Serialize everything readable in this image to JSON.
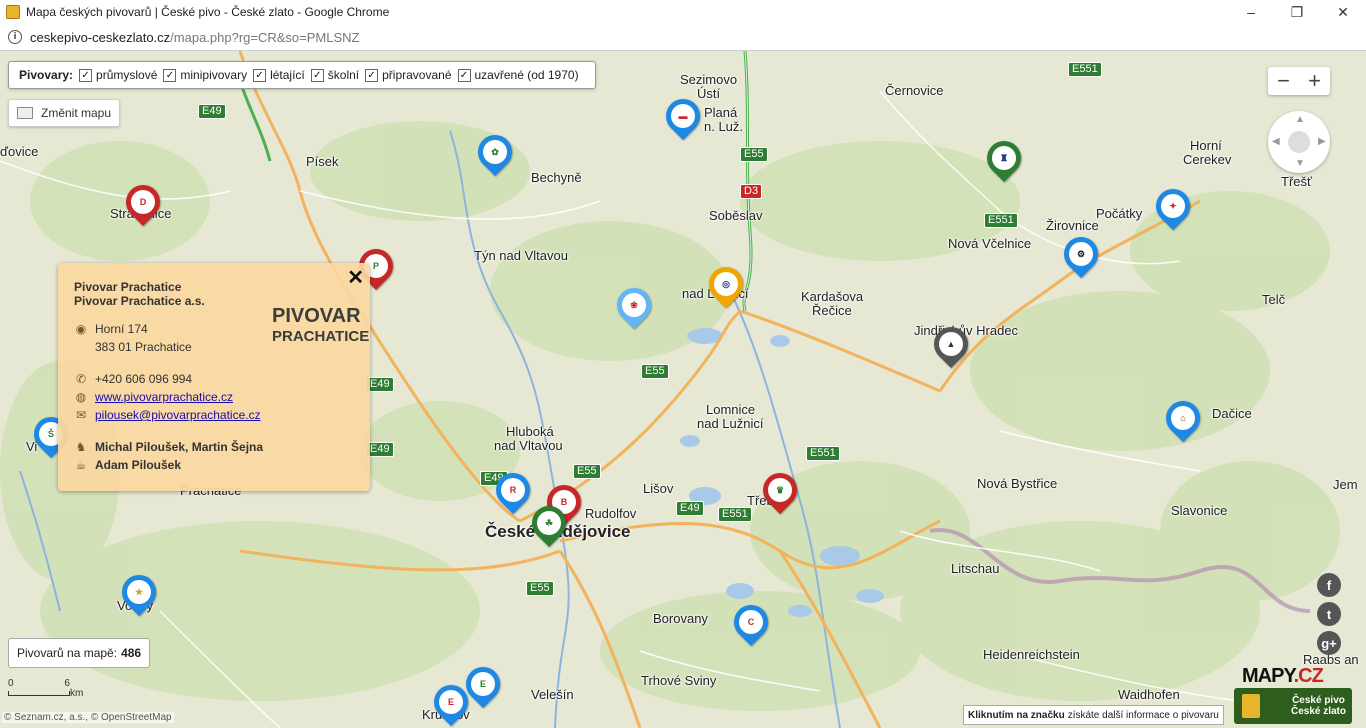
{
  "window": {
    "title": "Mapa českých pivovarů | České pivo - České zlato - Google Chrome",
    "minimize": "–",
    "restore": "❐",
    "close": "✕"
  },
  "address": {
    "host": "ceskepivo-ceskezlato.cz",
    "path": "/mapa.php?rg=CR&so=PMLSNZ"
  },
  "filter": {
    "label": "Pivovary:",
    "options": [
      {
        "label": "průmyslové",
        "checked": true
      },
      {
        "label": "minipivovary",
        "checked": true
      },
      {
        "label": "létající",
        "checked": true
      },
      {
        "label": "školní",
        "checked": true
      },
      {
        "label": "připravované",
        "checked": true
      },
      {
        "label": "uzavřené (od 1970)",
        "checked": true
      }
    ]
  },
  "change_map": "Změnit mapu",
  "zoom": {
    "minus": "−",
    "plus": "+"
  },
  "places": {
    "sezimovo1": "Sezimovo",
    "sezimovo2": "Ústí",
    "plana1": "Planá",
    "plana2": "n. Luž.",
    "cernovice": "Černovice",
    "pisek": "Písek",
    "bechyne": "Bechyně",
    "sobeslav": "Soběslav",
    "kardasova1": "Kardašova",
    "kardasova2": "Řečice",
    "horni1": "Horní",
    "horni2": "Cerekev",
    "trest": "Třešť",
    "pocatky": "Počátky",
    "zirovnice": "Žirovnice",
    "novavcelnice": "Nová Včelnice",
    "stradonice": "Strakonice",
    "dovice": "ďovice",
    "tyn": "Týn nad Vltavou",
    "veseli2": "nad Lužnicí",
    "telc": "Telč",
    "jindrichuv": "Jindřichův Hradec",
    "dacice": "Dačice",
    "lomnice1": "Lomnice",
    "lomnice2": "nad Lužnicí",
    "hluboka1": "Hluboká",
    "hluboka2": "nad Vltavou",
    "lisov": "Lišov",
    "rudolfov": "Rudolfov",
    "budejovice": "České Budějovice",
    "trebon": "Třeboň",
    "novabystrice": "Nová Bystřice",
    "slavonice": "Slavonice",
    "litschau": "Litschau",
    "borovany": "Borovany",
    "heidenreichstein": "Heidenreichstein",
    "trhove": "Trhové Sviny",
    "velesin": "Velešín",
    "krumlov": "Krumlov",
    "waidhofen": "Waidhofen",
    "raabs1": "Raabs an",
    "jemnice": "Jem",
    "volary": "Volary",
    "prachatice": "Prachatice",
    "vimperk": "Vi"
  },
  "roads": [
    "E49",
    "E55",
    "D3",
    "E551",
    "E49",
    "E55",
    "E49",
    "E551",
    "E49",
    "E55",
    "E49",
    "E551",
    "E551",
    "E55"
  ],
  "popup": {
    "name": "Pivovar Prachatice",
    "company": "Pivovar Prachatice a.s.",
    "logo_line1": "PIVOVAR",
    "logo_line2": "PRACHATICE",
    "street": "Horní 174",
    "city": "383 01 Prachatice",
    "phone": "+420 606 096 994",
    "web": "www.pivovarprachatice.cz",
    "email": "pilousek@pivovarprachatice.cz",
    "people1": "Michal Piloušek, Martin Šejna",
    "people2": "Adam Piloušek",
    "close": "✕"
  },
  "count": {
    "label": "Pivovarů na mapě:",
    "value": "486"
  },
  "scale": {
    "from": "0",
    "to": "6",
    "unit": "km"
  },
  "attribution": "© Seznam.cz, a.s., © OpenStreetMap",
  "hint": {
    "bold": "Kliknutím na značku",
    "rest": "získáte další informace o pivovaru"
  },
  "mapy_logo": {
    "a": "MAPY",
    "b": ".CZ"
  },
  "cp_logo": {
    "l1": "České pivo",
    "l2": "České zlato"
  },
  "social": [
    "f",
    "t",
    "g+"
  ]
}
